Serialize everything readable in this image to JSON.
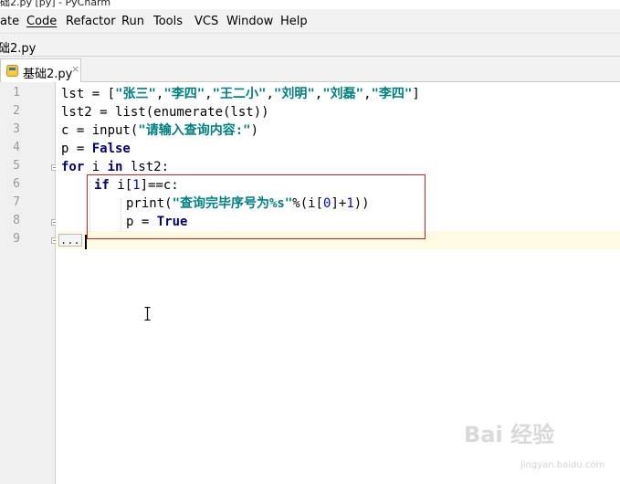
{
  "window": {
    "title": "础2.py [py] - PyCharm"
  },
  "menu": [
    "ate",
    "Code",
    "Refactor",
    "Run",
    "Tools",
    "VCS",
    "Window",
    "Help"
  ],
  "navbar": {
    "crumb": "础2.py"
  },
  "tab": {
    "label": "基础2.py",
    "close": "×"
  },
  "line_numbers": [
    "1",
    "2",
    "3",
    "4",
    "5",
    "6",
    "7",
    "8",
    "9"
  ],
  "code": {
    "l1": {
      "a": "lst = [",
      "s1": "\"张三\"",
      "c1": ",",
      "s2": "\"李四\"",
      "c2": ",",
      "s3": "\"王二小\"",
      "c3": ",",
      "s4": "\"刘明\"",
      "c4": ",",
      "s5": "\"刘磊\"",
      "c5": ",",
      "s6": "\"李四\"",
      "b": "]"
    },
    "l2": {
      "a": "lst2 = list(enumerate(lst))"
    },
    "l3": {
      "a": "c = input(",
      "s": "\"请输入查询内容:\"",
      "b": ")"
    },
    "l4": {
      "a": "p = ",
      "k": "False"
    },
    "l5": {
      "k1": "for",
      "a": " i ",
      "k2": "in",
      "b": " lst2:"
    },
    "l6": {
      "k": "if",
      "a": " i[",
      "n": "1",
      "b": "]==c:"
    },
    "l7": {
      "a": "print(",
      "s": "\"查询完毕序号为%s\"",
      "b": "%(i[",
      "n1": "0",
      "c": "]+",
      "n2": "1",
      "d": "))"
    },
    "l8": {
      "a": "p = ",
      "k": "True"
    },
    "l9": {
      "dots": "..."
    }
  },
  "watermark": {
    "brand": "Bai 经验",
    "url": "jingyan.baidu.com"
  }
}
